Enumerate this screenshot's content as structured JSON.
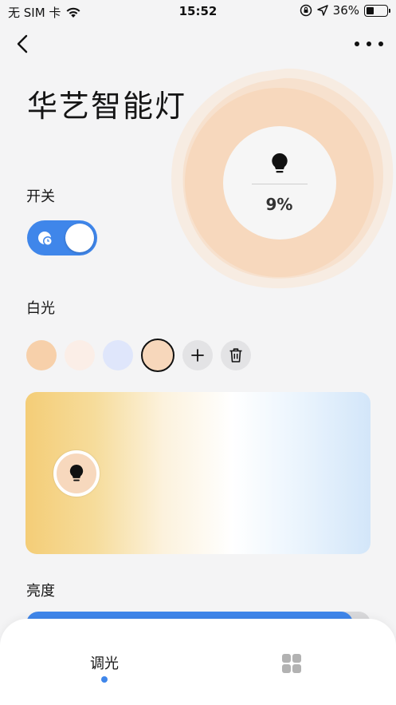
{
  "status_bar": {
    "carrier": "无 SIM 卡",
    "time": "15:52",
    "battery_percent": "36%",
    "battery_level": 0.36,
    "icons": [
      "wifi-icon",
      "orientation-lock-icon",
      "location-icon",
      "battery-icon"
    ]
  },
  "nav": {
    "back_icon": "chevron-left-icon",
    "more_icon": "more-horizontal-icon"
  },
  "device": {
    "title": "华艺智能灯",
    "brightness_display": "9%",
    "brightness_value": 0.09,
    "bulb_icon": "light-bulb-icon"
  },
  "sections": {
    "power_label": "开关",
    "white_light_label": "白光",
    "brightness_label": "亮度"
  },
  "power_switch": {
    "on": true,
    "icon": "timer-icon"
  },
  "swatches": [
    {
      "color": "#f7d0aa",
      "selected": false
    },
    {
      "color": "#fbeee7",
      "selected": false
    },
    {
      "color": "#dfe6fb",
      "selected": false
    },
    {
      "color": "#f7d7bb",
      "selected": true
    }
  ],
  "swatch_actions": {
    "add_icon": "plus-icon",
    "delete_icon": "trash-icon"
  },
  "color_picker": {
    "gradient": [
      "#f4cd77",
      "#f6dc9b",
      "#fcf2dd",
      "#ffffff",
      "#eaf4fd",
      "#d3e6f9"
    ],
    "handle_color": "#f7d8bd"
  },
  "brightness_slider": {
    "level": 0.95,
    "fill_color": "#3f86ea"
  },
  "bottom_tabs": {
    "dimming_label": "调光",
    "scenes_icon": "grid-icon"
  },
  "colors": {
    "accent": "#3f86ea",
    "background": "#f4f4f5"
  }
}
